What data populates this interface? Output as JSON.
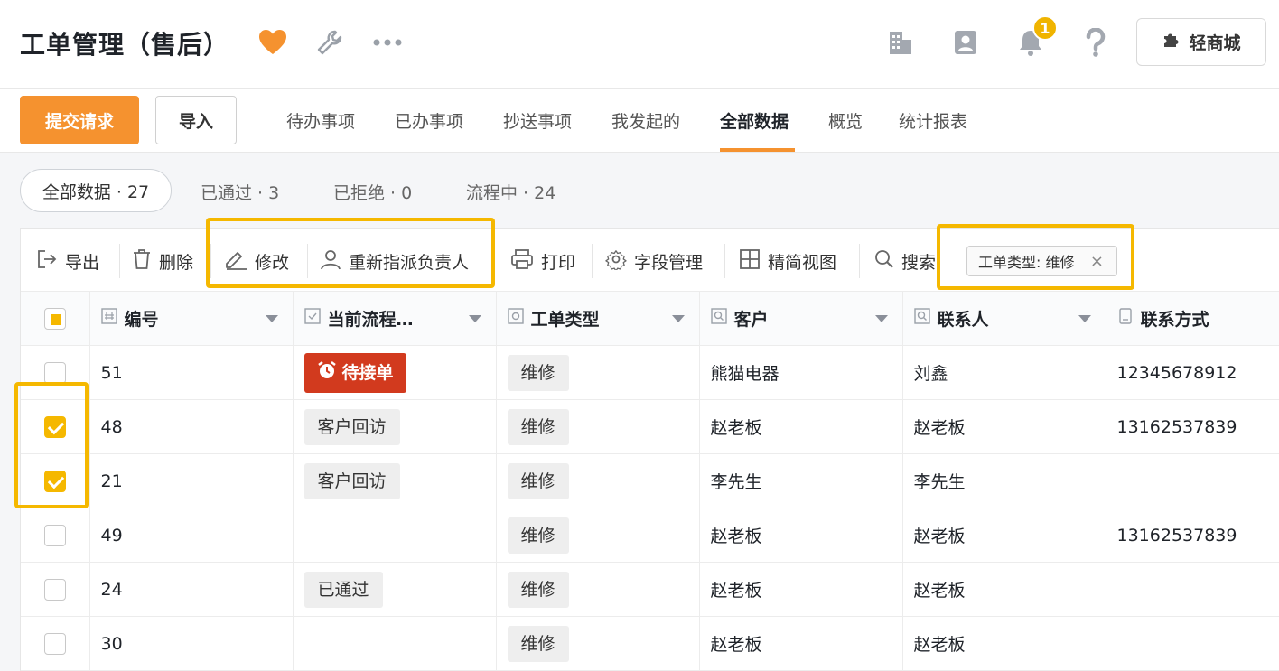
{
  "header": {
    "title": "工单管理（售后）",
    "notification_count": "1",
    "shop_button_label": "轻商城"
  },
  "nav": {
    "submit_label": "提交请求",
    "import_label": "导入",
    "tabs": [
      {
        "label": "待办事项",
        "active": false
      },
      {
        "label": "已办事项",
        "active": false
      },
      {
        "label": "抄送事项",
        "active": false
      },
      {
        "label": "我发起的",
        "active": false
      },
      {
        "label": "全部数据",
        "active": true
      },
      {
        "label": "概览",
        "active": false
      },
      {
        "label": "统计报表",
        "active": false
      }
    ]
  },
  "status_filters": [
    {
      "label": "全部数据 · 27",
      "selected": true
    },
    {
      "label": "已通过 · 3",
      "selected": false
    },
    {
      "label": "已拒绝 · 0",
      "selected": false
    },
    {
      "label": "流程中 · 24",
      "selected": false
    }
  ],
  "toolbar": {
    "export": "导出",
    "delete": "删除",
    "edit": "修改",
    "reassign": "重新指派负责人",
    "print": "打印",
    "fields": "字段管理",
    "compact_view": "精简视图",
    "search": "搜索",
    "filter_chip": "工单类型: 维修",
    "filter_chip_close": "×"
  },
  "table": {
    "columns": [
      "编号",
      "当前流程…",
      "工单类型",
      "客户",
      "联系人",
      "联系方式"
    ],
    "rows": [
      {
        "checked": false,
        "id": "51",
        "flow": "待接单",
        "flow_style": "red",
        "type": "维修",
        "customer": "熊猫电器",
        "contact": "刘鑫",
        "phone": "12345678912"
      },
      {
        "checked": true,
        "id": "48",
        "flow": "客户回访",
        "flow_style": "gray",
        "type": "维修",
        "customer": "赵老板",
        "contact": "赵老板",
        "phone": "13162537839"
      },
      {
        "checked": true,
        "id": "21",
        "flow": "客户回访",
        "flow_style": "gray",
        "type": "维修",
        "customer": "李先生",
        "contact": "李先生",
        "phone": ""
      },
      {
        "checked": false,
        "id": "49",
        "flow": "",
        "flow_style": "none",
        "type": "维修",
        "customer": "赵老板",
        "contact": "赵老板",
        "phone": "13162537839"
      },
      {
        "checked": false,
        "id": "24",
        "flow": "已通过",
        "flow_style": "gray",
        "type": "维修",
        "customer": "赵老板",
        "contact": "赵老板",
        "phone": ""
      },
      {
        "checked": false,
        "id": "30",
        "flow": "",
        "flow_style": "none",
        "type": "维修",
        "customer": "赵老板",
        "contact": "赵老板",
        "phone": ""
      }
    ]
  },
  "colors": {
    "accent_orange": "#f5922f",
    "highlight_yellow": "#f5b800",
    "pending_red": "#d23a1e"
  }
}
